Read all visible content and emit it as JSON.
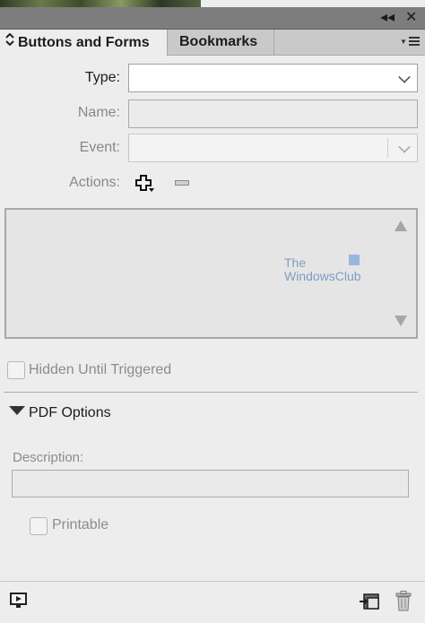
{
  "panel": {
    "collapse_icon": "double-chevron-left-icon",
    "close_icon": "close-icon",
    "collapse_glyph": "◂◂",
    "close_glyph": "✕"
  },
  "tabs": [
    {
      "label": "Buttons and Forms",
      "active": true
    },
    {
      "label": "Bookmarks",
      "active": false
    }
  ],
  "form": {
    "type_label": "Type:",
    "type_value": "",
    "name_label": "Name:",
    "name_value": "",
    "event_label": "Event:",
    "event_value": "",
    "actions_label": "Actions:"
  },
  "actions_list": {
    "items": [],
    "watermark_line1": "The",
    "watermark_line2": "WindowsClub"
  },
  "hidden_until_triggered": {
    "label": "Hidden Until Triggered",
    "checked": false
  },
  "pdf_options": {
    "title": "PDF Options",
    "description_label": "Description:",
    "description_value": "",
    "printable_label": "Printable",
    "printable_checked": false
  },
  "colors": {
    "panel_bg": "#ededed",
    "tab_bar_bg": "#c9c9c9",
    "header_bar_bg": "#7d7d7d"
  }
}
